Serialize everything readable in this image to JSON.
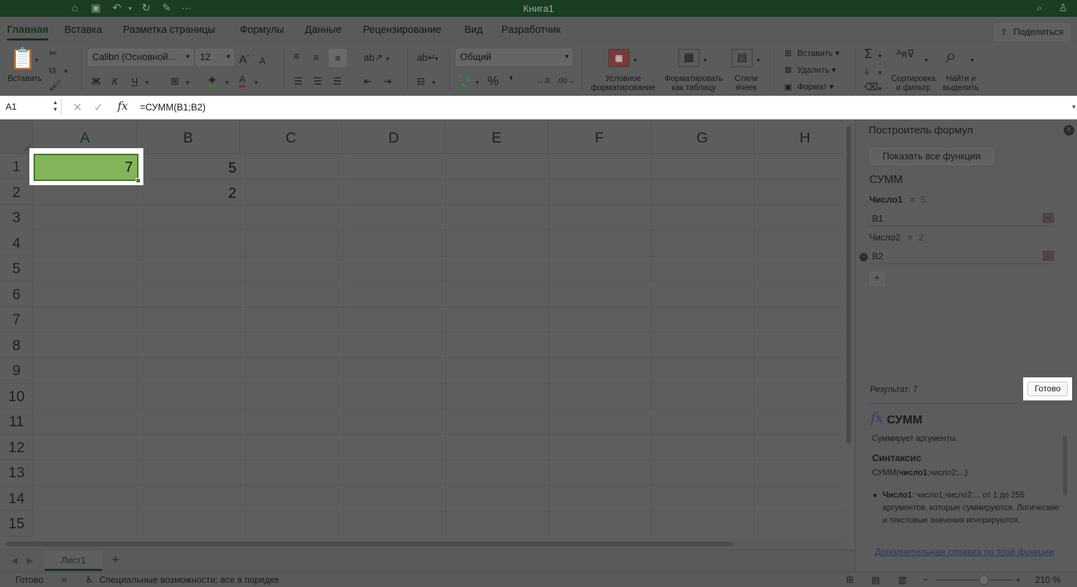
{
  "window": {
    "title": "Книга1"
  },
  "ribbon_tabs": [
    {
      "label": "Главная",
      "active": true
    },
    {
      "label": "Вставка"
    },
    {
      "label": "Разметка страницы"
    },
    {
      "label": "Формулы"
    },
    {
      "label": "Данные"
    },
    {
      "label": "Рецензирование"
    },
    {
      "label": "Вид"
    },
    {
      "label": "Разработчик"
    }
  ],
  "share_label": "Поделиться",
  "ribbon": {
    "paste_label": "Вставить",
    "font_name": "Calibri (Основной...",
    "font_size": "12",
    "bold": "Ж",
    "italic": "К",
    "underline": "Ч",
    "number_format": "Общий",
    "percent": "%",
    "cond_format_label": "Условное\nформатирование",
    "format_table_label": "Форматировать\nкак таблицу",
    "cell_styles_label": "Стили\nячеек",
    "insert_label": "Вставить",
    "delete_label": "Удалить",
    "format_label": "Формат",
    "sort_filter_label": "Сортировка\nи фильтр",
    "find_select_label": "Найти и\nвыделить"
  },
  "formula_bar": {
    "name_box": "A1",
    "formula": "=СУММ(B1;B2)"
  },
  "grid": {
    "columns": [
      "A",
      "B",
      "C",
      "D",
      "E",
      "F",
      "G",
      "H"
    ],
    "rows": [
      "1",
      "2",
      "3",
      "4",
      "5",
      "6",
      "7",
      "8",
      "9",
      "10",
      "11",
      "12",
      "13",
      "14",
      "15"
    ],
    "selected_cell": "A1",
    "a1_value": "7",
    "b1_value": "5",
    "b2_value": "2"
  },
  "sheets": {
    "active": "Лист1"
  },
  "status": {
    "ready": "Готово",
    "accessibility": "Специальные возможности: все в порядке",
    "zoom": "210 %"
  },
  "formula_builder": {
    "title": "Построитель формул",
    "show_all_label": "Показать все функции",
    "function_name": "СУММ",
    "args": [
      {
        "label": "Число1",
        "eq": "=",
        "value": "5",
        "input": "B1"
      },
      {
        "label": "Число2",
        "eq": "=",
        "value": "2",
        "input": "B2"
      }
    ],
    "result_label": "Результат: 7",
    "done_label": "Готово",
    "help": {
      "fx": "fx",
      "name": "СУММ",
      "description": "Суммирует аргументы.",
      "syntax_heading": "Синтаксис",
      "syntax_prefix": "СУММ(",
      "syntax_bold": "число1",
      "syntax_suffix": ";число2;...)",
      "bullet_bold": "Число1",
      "bullet_text": ": число1;число2;... от 1 до 255 аргументов, которые суммируются. Логические и текстовые значения игнорируются.",
      "link": "Дополнительная справка по этой функции"
    }
  }
}
